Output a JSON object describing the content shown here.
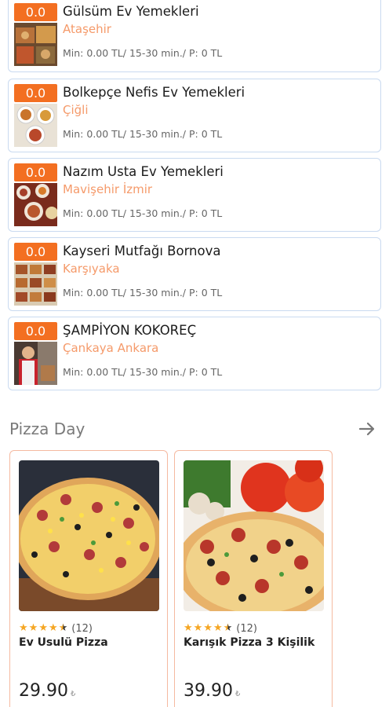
{
  "restaurants": [
    {
      "rating": "0.0",
      "name": "Gülsüm Ev Yemekleri",
      "location": "Ataşehir",
      "meta": "Min: 0.00 TL/ 15-30 min./ P: 0 TL"
    },
    {
      "rating": "0.0",
      "name": "Bolkepçe Nefis Ev Yemekleri",
      "location": "Çiğli",
      "meta": "Min: 0.00 TL/ 15-30 min./ P: 0 TL"
    },
    {
      "rating": "0.0",
      "name": "Nazım Usta Ev Yemekleri",
      "location": "Mavişehir İzmir",
      "meta": "Min: 0.00 TL/ 15-30 min./ P: 0 TL"
    },
    {
      "rating": "0.0",
      "name": "Kayseri Mutfağı Bornova",
      "location": "Karşıyaka",
      "meta": "Min: 0.00 TL/ 15-30 min./ P: 0 TL"
    },
    {
      "rating": "0.0",
      "name": "ŞAMPİYON KOKOREÇ",
      "location": "Çankaya Ankara",
      "meta": "Min: 0.00 TL/ 15-30 min./ P: 0 TL"
    }
  ],
  "section": {
    "title": "Pizza Day",
    "arrow_icon": "arrow-right-icon"
  },
  "products": [
    {
      "name": "Ev Usulü Pizza",
      "reviews": "(12)",
      "rating": 4.5,
      "price": "29.90",
      "currency": "₺"
    },
    {
      "name": "Karışık Pizza 3 Kişilik",
      "reviews": "(12)",
      "rating": 4.5,
      "price": "39.90",
      "currency": "₺"
    }
  ],
  "colors": {
    "badge": "#f36f21",
    "location": "#f59a6a",
    "card_border": "#c9daf0",
    "product_border": "#f5b9a0",
    "star": "#f5a623"
  }
}
